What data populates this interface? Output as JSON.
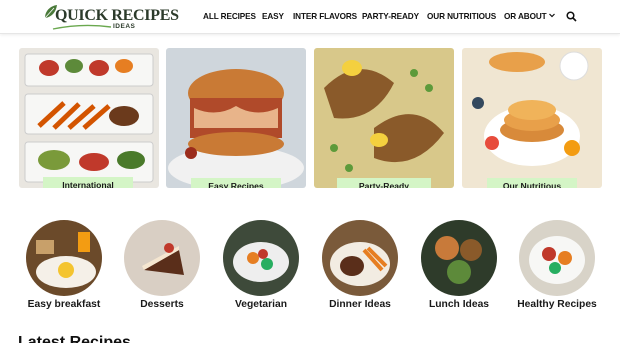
{
  "logo": {
    "text": "QUICK RECIPES",
    "sub": "IDEAS"
  },
  "nav": {
    "items": [
      "ALL RECIPES",
      "EASY",
      "INTER FLAVORS",
      "PARTY-READY",
      "OUR NUTRITIOUS",
      "OR ABOUT"
    ]
  },
  "cards": [
    {
      "label": "International Flavors"
    },
    {
      "label": "Easy Recipes"
    },
    {
      "label": "Party-Ready"
    },
    {
      "label": "Our Nutritious"
    }
  ],
  "categories": [
    {
      "label": "Easy breakfast"
    },
    {
      "label": "Desserts"
    },
    {
      "label": "Vegetarian"
    },
    {
      "label": "Dinner Ideas"
    },
    {
      "label": "Lunch Ideas"
    },
    {
      "label": "Healthy Recipes"
    }
  ],
  "section": {
    "title": "Latest Recipes"
  },
  "colors": {
    "label_bg": "#d4f5c6",
    "brand": "#2c3b2b"
  }
}
